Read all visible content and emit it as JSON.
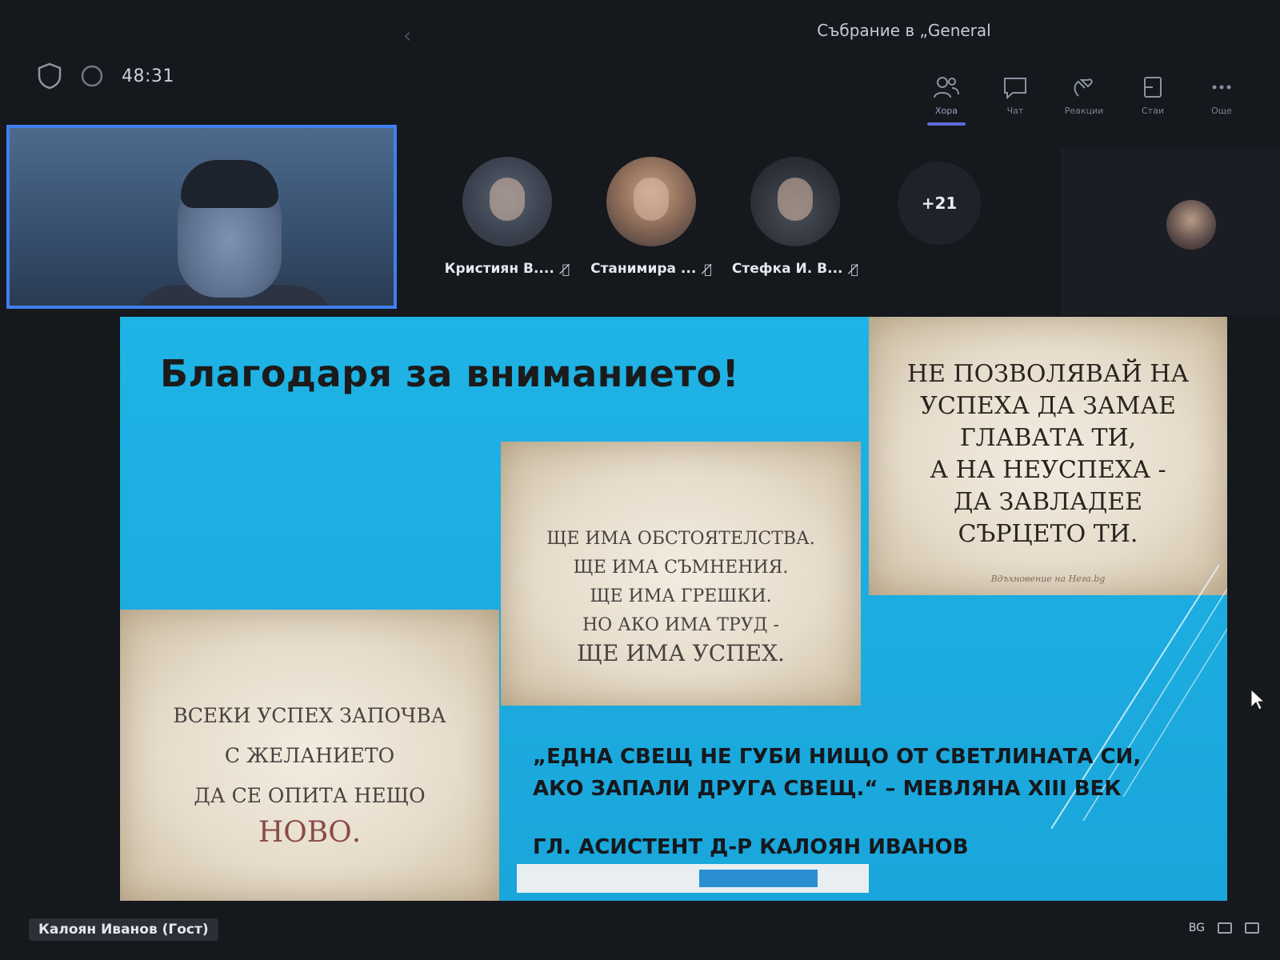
{
  "meeting": {
    "title": "Събрание в „General",
    "timer": "48:31"
  },
  "toolbar": {
    "items": [
      {
        "label": "Хора",
        "icon": "people-icon",
        "active": true
      },
      {
        "label": "Чат",
        "icon": "chat-icon",
        "active": false
      },
      {
        "label": "Реакции",
        "icon": "reactions-icon",
        "active": false
      },
      {
        "label": "Стаи",
        "icon": "rooms-icon",
        "active": false
      },
      {
        "label": "Още",
        "icon": "more-icon",
        "active": false
      }
    ]
  },
  "participants": [
    {
      "name": "Кристиян В....",
      "muted": true
    },
    {
      "name": "Станимира ...",
      "muted": true
    },
    {
      "name": "Стефка И. В...",
      "muted": true
    }
  ],
  "more_count": "+21",
  "slide": {
    "title": "Благодаря за вниманието!",
    "quote_right": [
      "НЕ ПОЗВОЛЯВАЙ НА",
      "УСПЕХА ДА ЗАМАЕ",
      "ГЛАВАТА ТИ,",
      "А НА НЕУСПЕХА -",
      "ДА ЗАВЛАДЕЕ",
      "СЪРЦЕТО ТИ."
    ],
    "quote_right_credit": "Вдъхновение на Нега.bg",
    "quote_middle": [
      "ЩЕ ИМА ОБСТОЯТЕЛСТВА.",
      "ЩЕ ИМА СЪМНЕНИЯ.",
      "ЩЕ ИМА ГРЕШКИ.",
      "НО АКО ИМА ТРУД -"
    ],
    "quote_middle_last": "ЩЕ ИМА УСПЕХ.",
    "quote_left": [
      "ВСЕКИ УСПЕХ ЗАПОЧВА",
      "С ЖЕЛАНИЕТО",
      "ДА СЕ ОПИТА НЕЩО"
    ],
    "quote_left_last": "НОВО.",
    "mevlana_line1": "„ЕДНА СВЕЩ НЕ ГУБИ НИЩО ОТ СВЕТЛИНАТА СИ,",
    "mevlana_line2": "АКО ЗАПАЛИ ДРУГА СВЕЩ.“ – МЕВЛЯНА XIII ВЕК",
    "author": "ГЛ. АСИСТЕНТ Д-Р КАЛОЯН ИВАНОВ",
    "colors": {
      "background": "#1fb3e6",
      "parchment": "#e6dccb",
      "text": "#15181c"
    }
  },
  "presenter": "Калоян Иванов (Гост)",
  "tray": {
    "language": "BG"
  },
  "colors": {
    "accent": "#3f7ff0",
    "toolbar_active": "#6169d6",
    "background": "#15181c"
  }
}
